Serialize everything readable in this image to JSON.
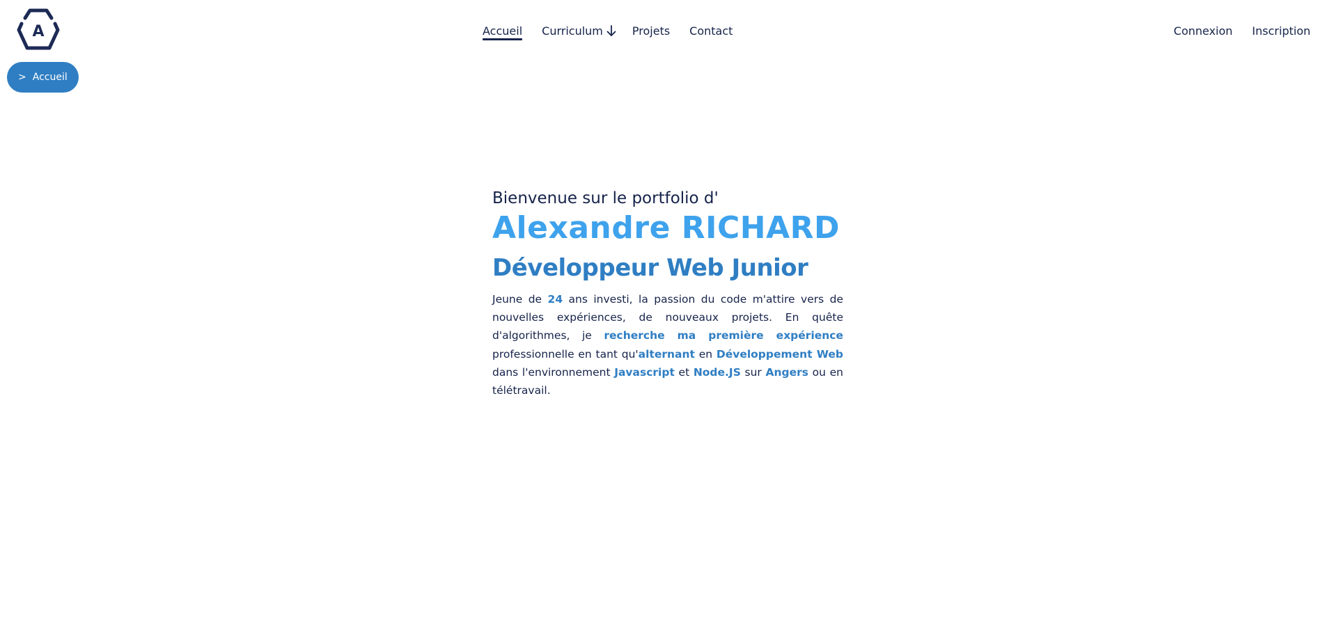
{
  "header": {
    "logo_letter": "A",
    "nav": {
      "accueil": "Accueil",
      "curriculum": "Curriculum",
      "projets": "Projets",
      "contact": "Contact"
    },
    "auth": {
      "connexion": "Connexion",
      "inscription": "Inscription"
    }
  },
  "breadcrumb": {
    "arrow": ">",
    "label": "Accueil"
  },
  "hero": {
    "welcome": "Bienvenue sur le portfolio d'",
    "name": "Alexandre RICHARD",
    "role": "Développeur Web Junior",
    "intro": {
      "t1": "Jeune de ",
      "age": "24",
      "t2": " ans investi, la passion du code m'attire vers de nouvelles expériences, de nouveaux projets. En quête d'algorithmes, je ",
      "search": "recherche ma première expérience",
      "t3": " professionnelle en tant qu'",
      "alternant": "alternant",
      "t4": " en ",
      "dev_web": "Développement Web",
      "t5": " dans l'environnement ",
      "javascript": "Javascript",
      "t6": " et ",
      "nodejs": "Node.JS",
      "t7": " sur ",
      "angers": "Angers",
      "t8": " ou en télétravail."
    }
  },
  "colors": {
    "navy": "#16234a",
    "name_blue": "#3ea2ec",
    "accent_blue": "#2f7ec3",
    "background": "#ffffff"
  },
  "icons": {
    "logo": "hexagon-logo-icon",
    "curriculum_dropdown": "arrow-down-icon"
  }
}
